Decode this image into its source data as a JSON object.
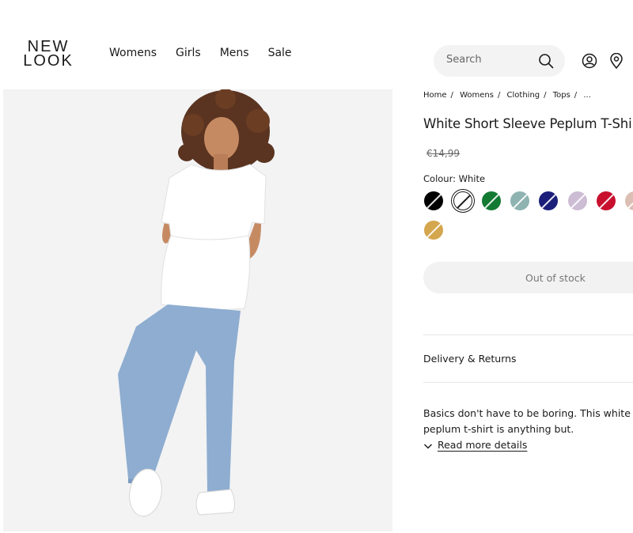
{
  "header": {
    "logo_line1": "NEW",
    "logo_line2": "LOOK",
    "nav": [
      "Womens",
      "Girls",
      "Mens",
      "Sale"
    ],
    "search_placeholder": "Search"
  },
  "breadcrumb": [
    "Home",
    "Womens",
    "Clothing",
    "Tops",
    "..."
  ],
  "product": {
    "title": "White Short Sleeve Peplum T-Shirt",
    "price": "€14,99",
    "colour_label": "Colour: White",
    "swatches": [
      {
        "name": "Black",
        "color": "#000000"
      },
      {
        "name": "White",
        "color": "#ffffff",
        "selected": true
      },
      {
        "name": "Green",
        "color": "#137a33"
      },
      {
        "name": "Sage",
        "color": "#8fb3b1"
      },
      {
        "name": "Navy",
        "color": "#1b1f7a"
      },
      {
        "name": "Lilac",
        "color": "#cdbdd4"
      },
      {
        "name": "Red",
        "color": "#c8102e"
      },
      {
        "name": "Pink",
        "color": "#dcbfb4"
      },
      {
        "name": "Mustard",
        "color": "#d4a64e"
      }
    ],
    "stock_button": "Out of stock",
    "delivery": "Delivery & Returns",
    "description": "Basics don't have to be boring. This white peplum t-shirt is anything but.",
    "read_more": "Read more details"
  }
}
